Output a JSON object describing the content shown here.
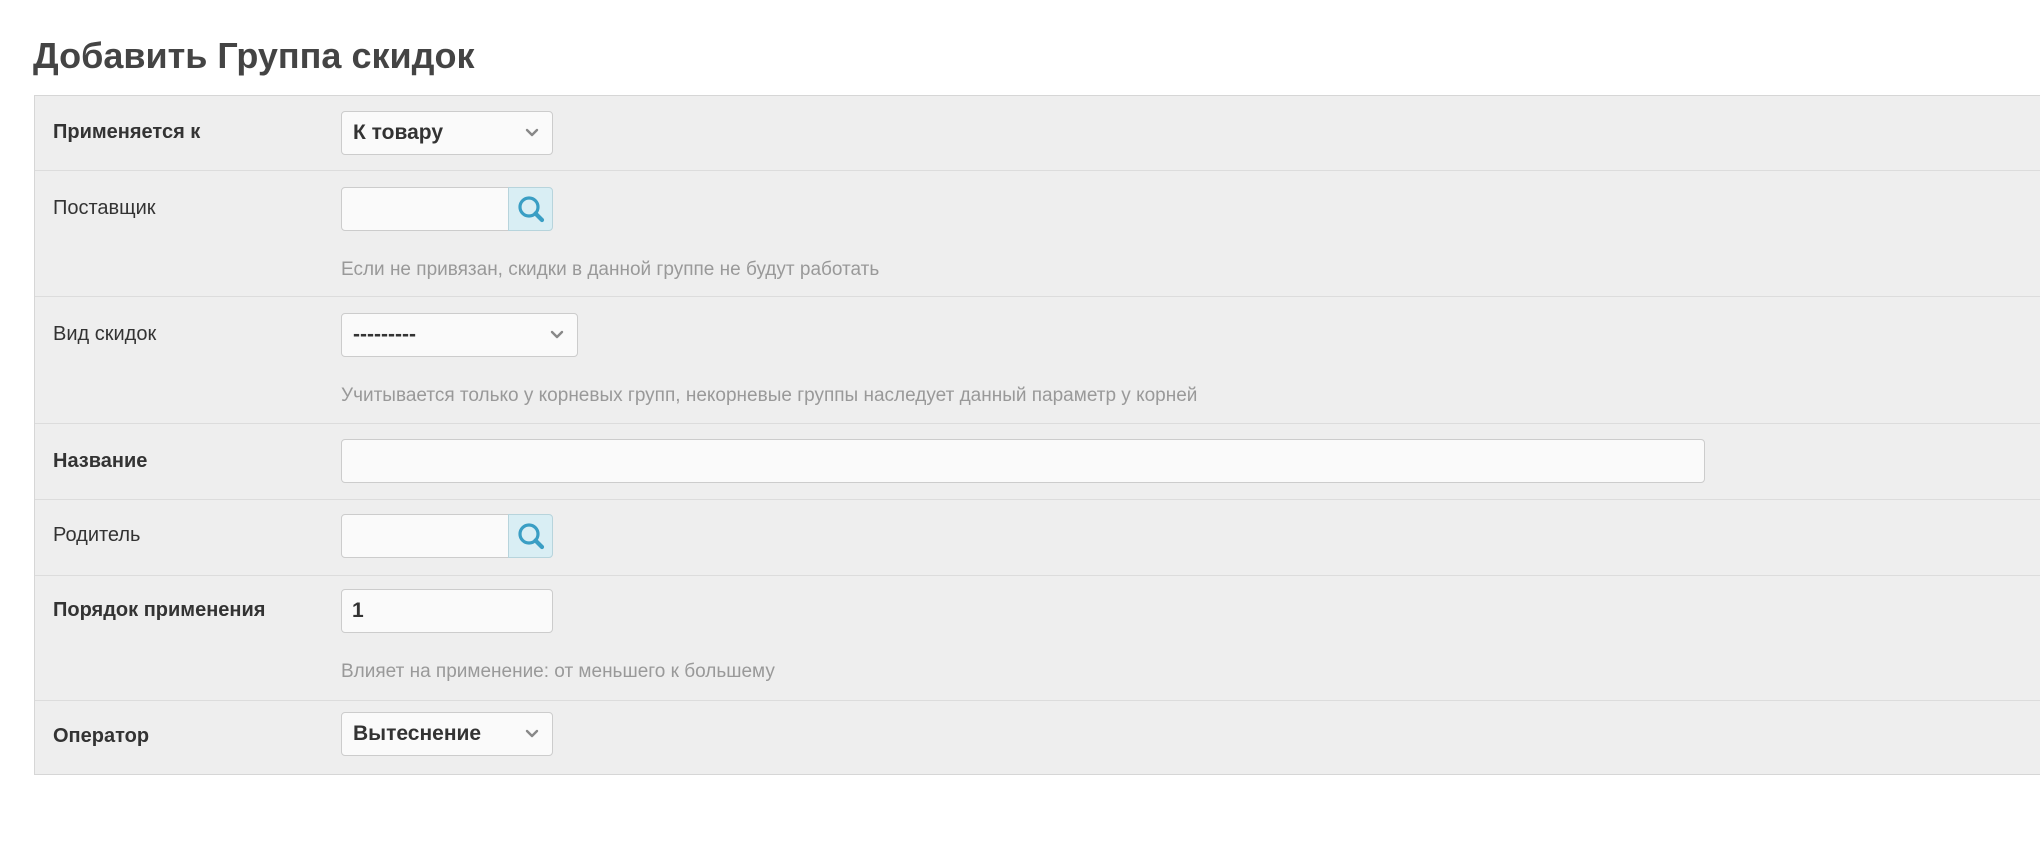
{
  "page": {
    "title": "Добавить Группа скидок"
  },
  "form": {
    "applies_to": {
      "label": "Применяется к",
      "value": "К товару"
    },
    "supplier": {
      "label": "Поставщик",
      "value": "",
      "help": "Если не привязан, скидки в данной группе не будут работать",
      "lookup_icon": "magnifier-icon"
    },
    "discount_type": {
      "label": "Вид скидок",
      "value": "---------",
      "help": "Учитывается только у корневых групп, некорневые группы наследует данный параметр у корней"
    },
    "name": {
      "label": "Название",
      "value": ""
    },
    "parent": {
      "label": "Родитель",
      "value": "",
      "lookup_icon": "magnifier-icon"
    },
    "order": {
      "label": "Порядок применения",
      "value": "1",
      "help": "Влияет на применение: от меньшего к большему"
    },
    "operator": {
      "label": "Оператор",
      "value": "Вытеснение"
    }
  },
  "colors": {
    "module_bg": "#eeeeee",
    "lookup_bg": "#d9eef4",
    "lookup_icon": "#3a9ec4",
    "help_text": "#999999"
  }
}
